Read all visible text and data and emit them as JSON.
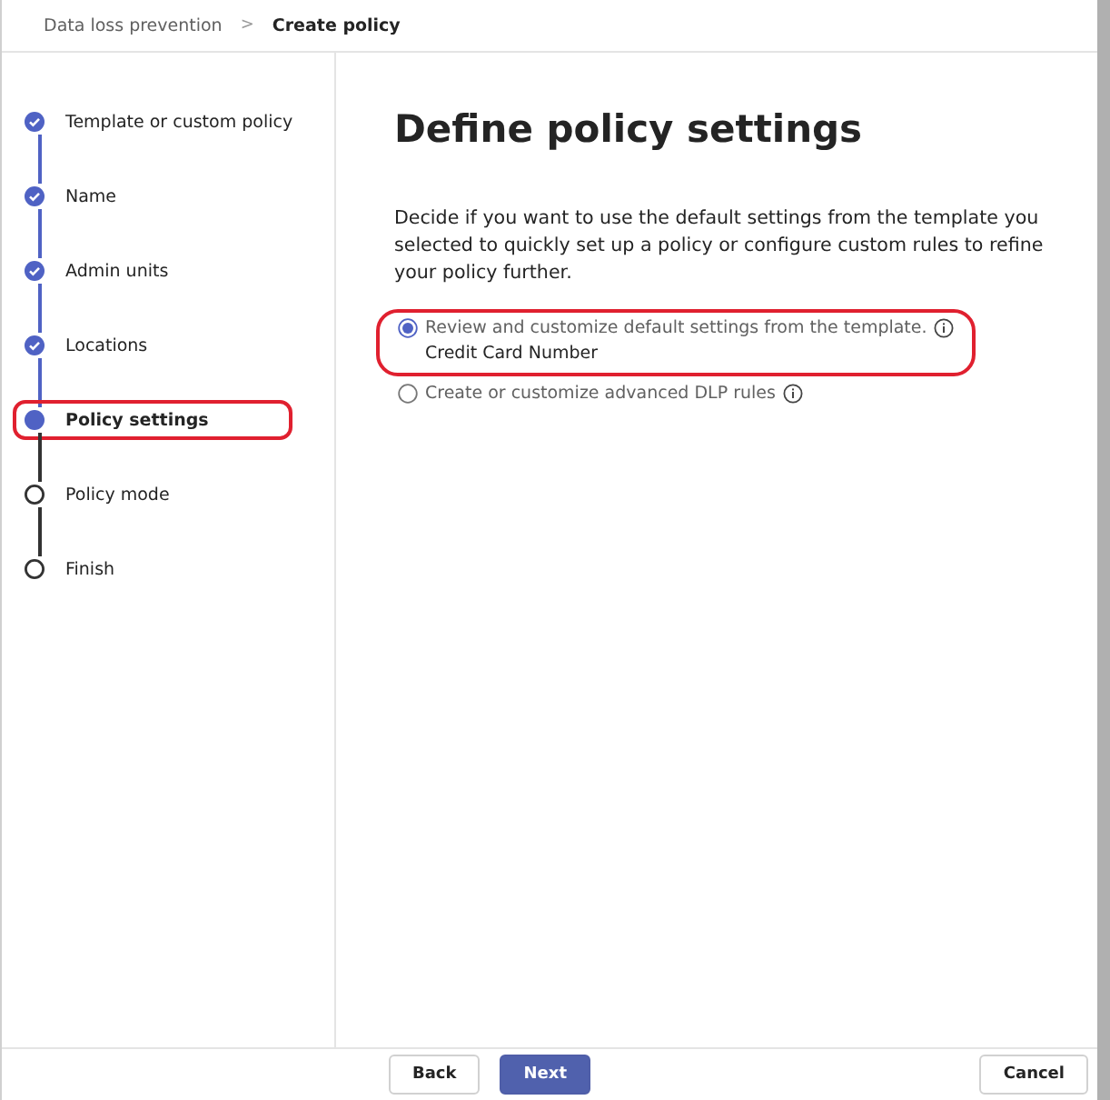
{
  "breadcrumb": [
    {
      "label": "Data loss prevention",
      "current": false
    },
    {
      "label": "Create policy",
      "current": true
    }
  ],
  "breadcrumb_separator": ">",
  "steps": [
    {
      "label": "Template or custom policy",
      "completed": true,
      "current": false,
      "highlighted": false
    },
    {
      "label": "Name",
      "completed": true,
      "current": false,
      "highlighted": false
    },
    {
      "label": "Admin units",
      "completed": true,
      "current": false,
      "highlighted": false
    },
    {
      "label": "Locations",
      "completed": true,
      "current": false,
      "highlighted": false
    },
    {
      "label": "Policy settings",
      "completed": false,
      "current": true,
      "highlighted": true
    },
    {
      "label": "Policy mode",
      "completed": false,
      "current": false,
      "highlighted": false
    },
    {
      "label": "Finish",
      "completed": false,
      "current": false,
      "highlighted": false
    }
  ],
  "title": "Define policy settings",
  "description": "Decide if you want to use the default settings from the template you selected to quickly set up a policy or configure custom rules to refine your policy further.",
  "options": [
    {
      "label": "Review and customize default settings from the template.",
      "sublabel": "Credit Card Number",
      "selected": true,
      "highlighted": true
    },
    {
      "label": "Create or customize advanced DLP rules",
      "selected": false,
      "highlighted": false
    }
  ],
  "footer": {
    "back": "Back",
    "next": "Next",
    "cancel": "Cancel"
  }
}
